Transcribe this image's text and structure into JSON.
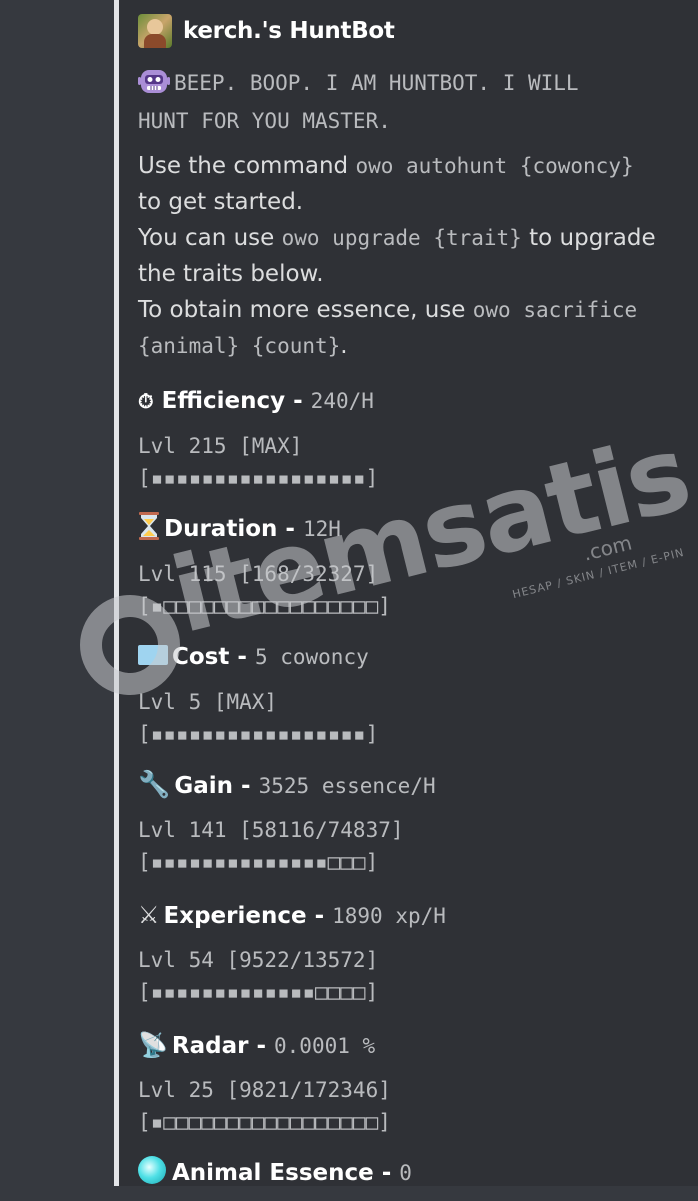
{
  "author": {
    "name": "kerch.'s HuntBot"
  },
  "intro": {
    "beep_line1": "BEEP. BOOP. I AM HUNTBOT. I WILL",
    "beep_line2": "HUNT FOR YOU MASTER."
  },
  "description": {
    "line1_text": "Use the command ",
    "line1_code": "owo autohunt {cowoncy}",
    "line2_text": "to get started.",
    "line3_text": "You can use ",
    "line3_code": "owo upgrade {trait}",
    "line3_text2": " to upgrade",
    "line4_text": "the traits below.",
    "line5_text": "To obtain more essence, use ",
    "line5_code": "owo sacrifice",
    "line6_code": "{animal} {count}",
    "line6_text": "."
  },
  "fields": [
    {
      "icon": "timer-icon",
      "name": "Efficiency",
      "sep": " - ",
      "value": "240/H",
      "level": "Lvl 215 [MAX]",
      "bar": "[▪▪▪▪▪▪▪▪▪▪▪▪▪▪▪▪▪]"
    },
    {
      "icon": "hourglass-icon",
      "name": "Duration",
      "sep": " - ",
      "value": "12H",
      "level": "Lvl 115 [168/32327]",
      "bar": "[▪□□□□□□□□□□□□□□□□□]"
    },
    {
      "icon": "ticket-icon",
      "name": "Cost",
      "sep": " - ",
      "value": "5 cowoncy",
      "level": "Lvl 5 [MAX]",
      "bar": "[▪▪▪▪▪▪▪▪▪▪▪▪▪▪▪▪▪]"
    },
    {
      "icon": "wrench-icon",
      "name": "Gain",
      "sep": " - ",
      "value": "3525 essence/H",
      "level": "Lvl 141 [58116/74837]",
      "bar": "[▪▪▪▪▪▪▪▪▪▪▪▪▪▪□□□]"
    },
    {
      "icon": "crossed-swords-icon",
      "name": "Experience",
      "sep": " - ",
      "value": "1890 xp/H",
      "level": "Lvl 54 [9522/13572]",
      "bar": "[▪▪▪▪▪▪▪▪▪▪▪▪▪□□□□]"
    },
    {
      "icon": "satellite-icon",
      "name": "Radar",
      "sep": " - ",
      "value": "0.0001 %",
      "level": "Lvl 25 [9821/172346]",
      "bar": "[▪□□□□□□□□□□□□□□□□□]"
    },
    {
      "icon": "orb-icon",
      "name": "Animal Essence",
      "sep": " - ",
      "value": "0"
    }
  ],
  "watermark": {
    "text": "itemsatis",
    "sub": "HESAP / SKIN / ITEM / E-PIN",
    "domain": ".com"
  }
}
